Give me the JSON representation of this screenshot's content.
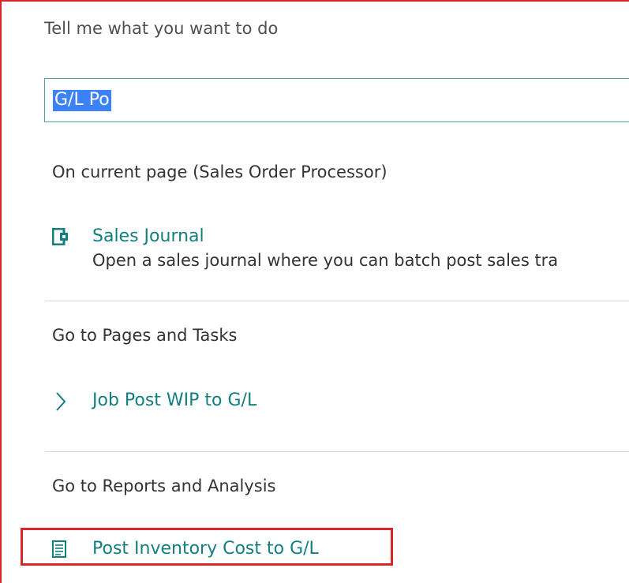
{
  "header": {
    "title": "Tell me what you want to do"
  },
  "search": {
    "value": "G/L Po"
  },
  "sections": {
    "current_page": {
      "title": "On current page (Sales Order Processor)",
      "items": [
        {
          "label": "Sales Journal",
          "description": "Open a sales journal where you can batch post sales tra",
          "icon": "journal-icon"
        }
      ]
    },
    "pages_tasks": {
      "title": "Go to Pages and Tasks",
      "items": [
        {
          "label": "Job Post WIP to G/L",
          "icon": "chevron-right-icon"
        }
      ]
    },
    "reports": {
      "title": "Go to Reports and Analysis",
      "items": [
        {
          "label": "Post Inventory Cost to G/L",
          "icon": "report-icon"
        }
      ]
    }
  },
  "colors": {
    "accent": "#137f7f",
    "selection": "#3b82f6",
    "highlight_border": "#d9262c"
  }
}
